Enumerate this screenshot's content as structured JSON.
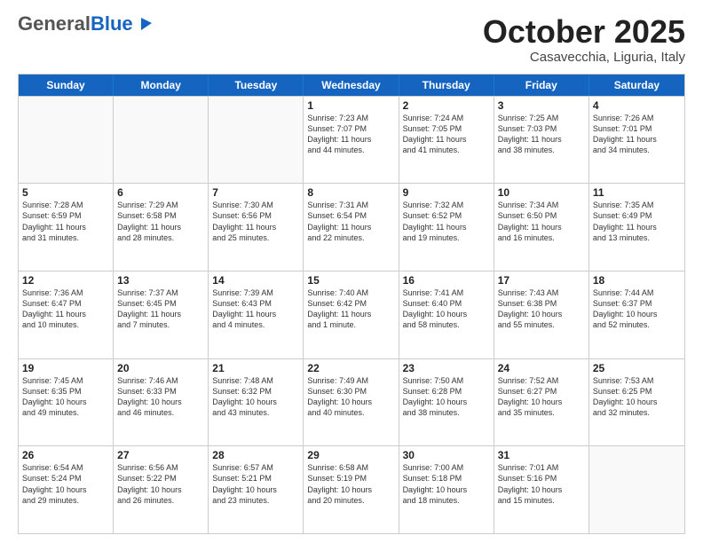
{
  "logo": {
    "general": "General",
    "blue": "Blue"
  },
  "title": "October 2025",
  "location": "Casavecchia, Liguria, Italy",
  "days": [
    "Sunday",
    "Monday",
    "Tuesday",
    "Wednesday",
    "Thursday",
    "Friday",
    "Saturday"
  ],
  "rows": [
    [
      {
        "day": "",
        "info": ""
      },
      {
        "day": "",
        "info": ""
      },
      {
        "day": "",
        "info": ""
      },
      {
        "day": "1",
        "info": "Sunrise: 7:23 AM\nSunset: 7:07 PM\nDaylight: 11 hours\nand 44 minutes."
      },
      {
        "day": "2",
        "info": "Sunrise: 7:24 AM\nSunset: 7:05 PM\nDaylight: 11 hours\nand 41 minutes."
      },
      {
        "day": "3",
        "info": "Sunrise: 7:25 AM\nSunset: 7:03 PM\nDaylight: 11 hours\nand 38 minutes."
      },
      {
        "day": "4",
        "info": "Sunrise: 7:26 AM\nSunset: 7:01 PM\nDaylight: 11 hours\nand 34 minutes."
      }
    ],
    [
      {
        "day": "5",
        "info": "Sunrise: 7:28 AM\nSunset: 6:59 PM\nDaylight: 11 hours\nand 31 minutes."
      },
      {
        "day": "6",
        "info": "Sunrise: 7:29 AM\nSunset: 6:58 PM\nDaylight: 11 hours\nand 28 minutes."
      },
      {
        "day": "7",
        "info": "Sunrise: 7:30 AM\nSunset: 6:56 PM\nDaylight: 11 hours\nand 25 minutes."
      },
      {
        "day": "8",
        "info": "Sunrise: 7:31 AM\nSunset: 6:54 PM\nDaylight: 11 hours\nand 22 minutes."
      },
      {
        "day": "9",
        "info": "Sunrise: 7:32 AM\nSunset: 6:52 PM\nDaylight: 11 hours\nand 19 minutes."
      },
      {
        "day": "10",
        "info": "Sunrise: 7:34 AM\nSunset: 6:50 PM\nDaylight: 11 hours\nand 16 minutes."
      },
      {
        "day": "11",
        "info": "Sunrise: 7:35 AM\nSunset: 6:49 PM\nDaylight: 11 hours\nand 13 minutes."
      }
    ],
    [
      {
        "day": "12",
        "info": "Sunrise: 7:36 AM\nSunset: 6:47 PM\nDaylight: 11 hours\nand 10 minutes."
      },
      {
        "day": "13",
        "info": "Sunrise: 7:37 AM\nSunset: 6:45 PM\nDaylight: 11 hours\nand 7 minutes."
      },
      {
        "day": "14",
        "info": "Sunrise: 7:39 AM\nSunset: 6:43 PM\nDaylight: 11 hours\nand 4 minutes."
      },
      {
        "day": "15",
        "info": "Sunrise: 7:40 AM\nSunset: 6:42 PM\nDaylight: 11 hours\nand 1 minute."
      },
      {
        "day": "16",
        "info": "Sunrise: 7:41 AM\nSunset: 6:40 PM\nDaylight: 10 hours\nand 58 minutes."
      },
      {
        "day": "17",
        "info": "Sunrise: 7:43 AM\nSunset: 6:38 PM\nDaylight: 10 hours\nand 55 minutes."
      },
      {
        "day": "18",
        "info": "Sunrise: 7:44 AM\nSunset: 6:37 PM\nDaylight: 10 hours\nand 52 minutes."
      }
    ],
    [
      {
        "day": "19",
        "info": "Sunrise: 7:45 AM\nSunset: 6:35 PM\nDaylight: 10 hours\nand 49 minutes."
      },
      {
        "day": "20",
        "info": "Sunrise: 7:46 AM\nSunset: 6:33 PM\nDaylight: 10 hours\nand 46 minutes."
      },
      {
        "day": "21",
        "info": "Sunrise: 7:48 AM\nSunset: 6:32 PM\nDaylight: 10 hours\nand 43 minutes."
      },
      {
        "day": "22",
        "info": "Sunrise: 7:49 AM\nSunset: 6:30 PM\nDaylight: 10 hours\nand 40 minutes."
      },
      {
        "day": "23",
        "info": "Sunrise: 7:50 AM\nSunset: 6:28 PM\nDaylight: 10 hours\nand 38 minutes."
      },
      {
        "day": "24",
        "info": "Sunrise: 7:52 AM\nSunset: 6:27 PM\nDaylight: 10 hours\nand 35 minutes."
      },
      {
        "day": "25",
        "info": "Sunrise: 7:53 AM\nSunset: 6:25 PM\nDaylight: 10 hours\nand 32 minutes."
      }
    ],
    [
      {
        "day": "26",
        "info": "Sunrise: 6:54 AM\nSunset: 5:24 PM\nDaylight: 10 hours\nand 29 minutes."
      },
      {
        "day": "27",
        "info": "Sunrise: 6:56 AM\nSunset: 5:22 PM\nDaylight: 10 hours\nand 26 minutes."
      },
      {
        "day": "28",
        "info": "Sunrise: 6:57 AM\nSunset: 5:21 PM\nDaylight: 10 hours\nand 23 minutes."
      },
      {
        "day": "29",
        "info": "Sunrise: 6:58 AM\nSunset: 5:19 PM\nDaylight: 10 hours\nand 20 minutes."
      },
      {
        "day": "30",
        "info": "Sunrise: 7:00 AM\nSunset: 5:18 PM\nDaylight: 10 hours\nand 18 minutes."
      },
      {
        "day": "31",
        "info": "Sunrise: 7:01 AM\nSunset: 5:16 PM\nDaylight: 10 hours\nand 15 minutes."
      },
      {
        "day": "",
        "info": ""
      }
    ]
  ]
}
